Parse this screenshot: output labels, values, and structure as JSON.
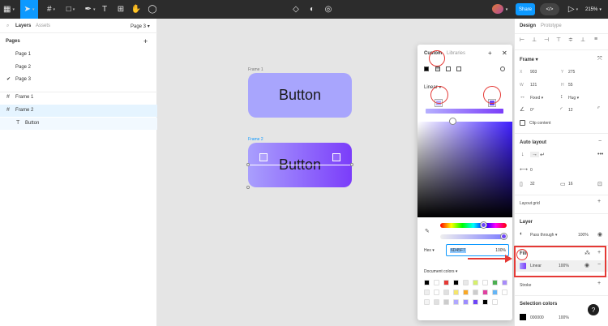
{
  "toolbar": {
    "share_label": "Share",
    "code_label": "</>",
    "zoom": "215%"
  },
  "left_panel": {
    "tabs": [
      "Layers",
      "Assets"
    ],
    "current_page": "Page 3",
    "pages_title": "Pages",
    "pages": [
      "Page 1",
      "Page 2",
      "Page 3"
    ],
    "layers": [
      "Frame 1",
      "Frame 2",
      "Button"
    ]
  },
  "canvas": {
    "frame1_label": "Frame 1",
    "frame2_label": "Frame 2",
    "frame1_text": "Button",
    "frame2_text": "Button"
  },
  "picker": {
    "tabs": [
      "Custom",
      "Libraries"
    ],
    "mode": "Linear",
    "hex_label": "Hex",
    "hex_value": "6D45F7",
    "opacity": "100%",
    "doc_colors_title": "Document colors",
    "swatches": [
      "#000000",
      "#ffffff",
      "#e53935",
      "#000000",
      "#e8e8e8",
      "#d6f06b",
      "#ffffff",
      "#4caf50",
      "#a78bfa",
      "#eeeeee",
      "#ffffff",
      "#e0e0e0",
      "#f5e56b",
      "#f9a825",
      "#cccccc",
      "#e040a0",
      "#64b5f6",
      "#ffffff",
      "#f4f4f4",
      "#e0e0e0",
      "#cccccc",
      "#b0a8ff",
      "#9c8cff",
      "#6d45f7",
      "#000000",
      "#ffffff"
    ]
  },
  "right_panel": {
    "tabs": [
      "Design",
      "Prototype"
    ],
    "frame_title": "Frame",
    "x": "903",
    "y": "275",
    "w": "121",
    "h": "55",
    "w_mode": "Fixed",
    "h_mode": "Hug",
    "rotation": "0°",
    "radius": "12",
    "clip": "Clip content",
    "auto_layout": "Auto layout",
    "gap": "0",
    "pad_h": "32",
    "pad_v": "16",
    "layout_grid": "Layout grid",
    "layer_title": "Layer",
    "blend": "Pass through",
    "layer_opacity": "100%",
    "fill_title": "Fill",
    "fill_type": "Linear",
    "fill_opacity": "100%",
    "stroke_title": "Stroke",
    "sel_colors_title": "Selection colors",
    "sel_color_hex": "000000",
    "sel_color_opacity": "100%"
  },
  "colors": {
    "accent": "#0d99ff",
    "annotation": "#e53935",
    "frame1_fill": "#a8a5fd",
    "gradient_end": "#7b3dfa"
  }
}
